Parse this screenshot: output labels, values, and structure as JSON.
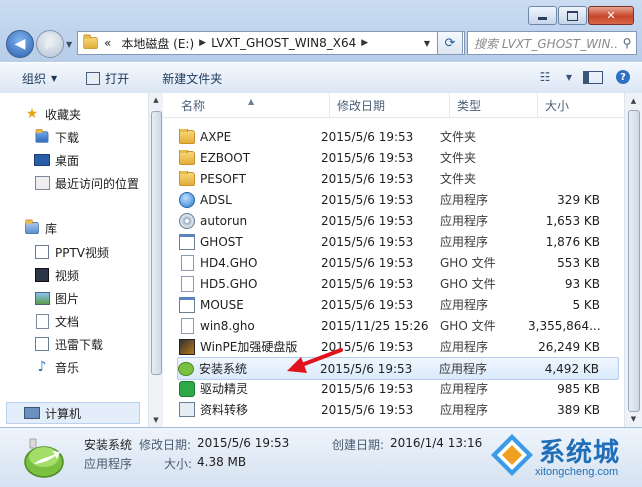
{
  "window": {
    "minimize_icon": "minimize-icon",
    "maximize_icon": "maximize-icon",
    "close_icon": "close-icon"
  },
  "address": {
    "breadcrumbs": [
      "«",
      "本地磁盘 (E:)",
      "LVXT_GHOST_WIN8_X64"
    ],
    "search_placeholder": "搜索 LVXT_GHOST_WIN..."
  },
  "toolbar": {
    "organize": "组织",
    "open": "打开",
    "new_folder": "新建文件夹"
  },
  "sidebar": {
    "items": [
      {
        "label": "收藏夹",
        "icon": "star-icon"
      },
      {
        "label": "下载",
        "icon": "download-folder-icon"
      },
      {
        "label": "桌面",
        "icon": "desktop-icon"
      },
      {
        "label": "最近访问的位置",
        "icon": "recent-places-icon"
      },
      {
        "label": "库",
        "icon": "library-icon"
      },
      {
        "label": "PPTV视频",
        "icon": "video-library-icon"
      },
      {
        "label": "视频",
        "icon": "video-icon"
      },
      {
        "label": "图片",
        "icon": "picture-icon"
      },
      {
        "label": "文档",
        "icon": "document-icon"
      },
      {
        "label": "迅雷下载",
        "icon": "thunder-download-icon"
      },
      {
        "label": "音乐",
        "icon": "music-icon"
      },
      {
        "label": "计算机",
        "icon": "computer-icon"
      }
    ]
  },
  "columns": [
    "名称",
    "修改日期",
    "类型",
    "大小"
  ],
  "files": [
    {
      "name": "AXPE",
      "date": "2015/5/6 19:53",
      "type": "文件夹",
      "size": "",
      "icon": "folder"
    },
    {
      "name": "EZBOOT",
      "date": "2015/5/6 19:53",
      "type": "文件夹",
      "size": "",
      "icon": "folder"
    },
    {
      "name": "PESOFT",
      "date": "2015/5/6 19:53",
      "type": "文件夹",
      "size": "",
      "icon": "folder"
    },
    {
      "name": "ADSL",
      "date": "2015/5/6 19:53",
      "type": "应用程序",
      "size": "329 KB",
      "icon": "globe"
    },
    {
      "name": "autorun",
      "date": "2015/5/6 19:53",
      "type": "应用程序",
      "size": "1,653 KB",
      "icon": "cd"
    },
    {
      "name": "GHOST",
      "date": "2015/5/6 19:53",
      "type": "应用程序",
      "size": "1,876 KB",
      "icon": "app"
    },
    {
      "name": "HD4.GHO",
      "date": "2015/5/6 19:53",
      "type": "GHO 文件",
      "size": "553 KB",
      "icon": "doc"
    },
    {
      "name": "HD5.GHO",
      "date": "2015/5/6 19:53",
      "type": "GHO 文件",
      "size": "93 KB",
      "icon": "doc"
    },
    {
      "name": "MOUSE",
      "date": "2015/5/6 19:53",
      "type": "应用程序",
      "size": "5 KB",
      "icon": "app"
    },
    {
      "name": "win8.gho",
      "date": "2015/11/25 15:26",
      "type": "GHO 文件",
      "size": "3,355,864...",
      "icon": "doc"
    },
    {
      "name": "WinPE加强硬盘版",
      "date": "2015/5/6 19:53",
      "type": "应用程序",
      "size": "26,249 KB",
      "icon": "winpe"
    },
    {
      "name": "安装系统",
      "date": "2015/5/6 19:53",
      "type": "应用程序",
      "size": "4,492 KB",
      "icon": "install",
      "selected": true
    },
    {
      "name": "驱动精灵",
      "date": "2015/5/6 19:53",
      "type": "应用程序",
      "size": "985 KB",
      "icon": "driver"
    },
    {
      "name": "资料转移",
      "date": "2015/5/6 19:53",
      "type": "应用程序",
      "size": "389 KB",
      "icon": "transfer"
    }
  ],
  "details": {
    "name": "安装系统",
    "modified_label": "修改日期:",
    "modified": "2015/5/6 19:53",
    "created_label": "创建日期:",
    "created": "2016/1/4 13:16",
    "type": "应用程序",
    "size_label": "大小:",
    "size": "4.38 MB"
  },
  "watermark": {
    "title": "系统城",
    "url": "xitongcheng.com"
  },
  "colors": {
    "accent": "#1f6fb8",
    "selection": "#dbeafc",
    "arrow": "#e0121b"
  }
}
